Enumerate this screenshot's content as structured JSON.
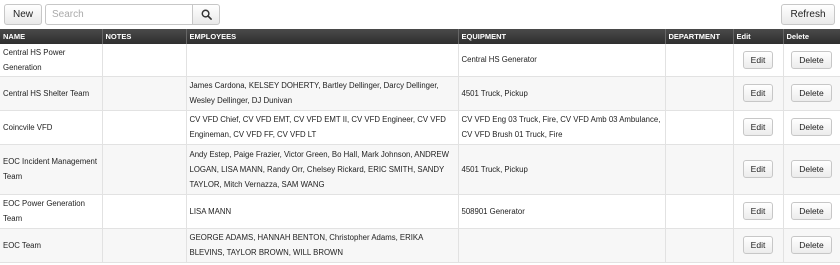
{
  "toolbar": {
    "new_label": "New",
    "search_placeholder": "Search",
    "search_value": "",
    "refresh_label": "Refresh"
  },
  "columns": {
    "name": "NAME",
    "notes": "NOTES",
    "employees": "EMPLOYEES",
    "equipment": "EQUIPMENT",
    "department": "DEPARTMENT",
    "edit": "Edit",
    "delete": "Delete"
  },
  "rows": [
    {
      "name": "Central HS Power Generation",
      "notes": "",
      "employees": "",
      "equipment": "Central HS Generator",
      "department": "",
      "edit_label": "Edit",
      "delete_label": "Delete"
    },
    {
      "name": "Central HS Shelter Team",
      "notes": "",
      "employees": "James Cardona, KELSEY DOHERTY, Bartley Dellinger, Darcy Dellinger, Wesley Dellinger, DJ Dunivan",
      "equipment": "4501 Truck, Pickup",
      "department": "",
      "edit_label": "Edit",
      "delete_label": "Delete"
    },
    {
      "name": "Coincvile VFD",
      "notes": "",
      "employees": "CV VFD Chief, CV VFD EMT, CV VFD EMT II, CV VFD Engineer, CV VFD Engineman, CV VFD FF, CV VFD LT",
      "equipment": "CV VFD Eng 03 Truck, Fire, CV VFD Amb 03 Ambulance, CV VFD Brush 01 Truck, Fire",
      "department": "",
      "edit_label": "Edit",
      "delete_label": "Delete"
    },
    {
      "name": "EOC Incident Management Team",
      "notes": "",
      "employees": "Andy Estep, Paige Frazier, Victor Green, Bo Hall, Mark Johnson, ANDREW LOGAN, LISA MANN, Randy Orr, Chelsey Rickard, ERIC SMITH, SANDY TAYLOR, Mitch Vernazza, SAM WANG",
      "equipment": "4501 Truck, Pickup",
      "department": "",
      "edit_label": "Edit",
      "delete_label": "Delete"
    },
    {
      "name": "EOC Power Generation Team",
      "notes": "",
      "employees": "LISA MANN",
      "equipment": "508901 Generator",
      "department": "",
      "edit_label": "Edit",
      "delete_label": "Delete"
    },
    {
      "name": "EOC Team",
      "notes": "",
      "employees": "GEORGE ADAMS, HANNAH BENTON, Christopher Adams, ERIKA BLEVINS, TAYLOR BROWN, WILL BROWN",
      "equipment": "",
      "department": "",
      "edit_label": "Edit",
      "delete_label": "Delete"
    }
  ]
}
